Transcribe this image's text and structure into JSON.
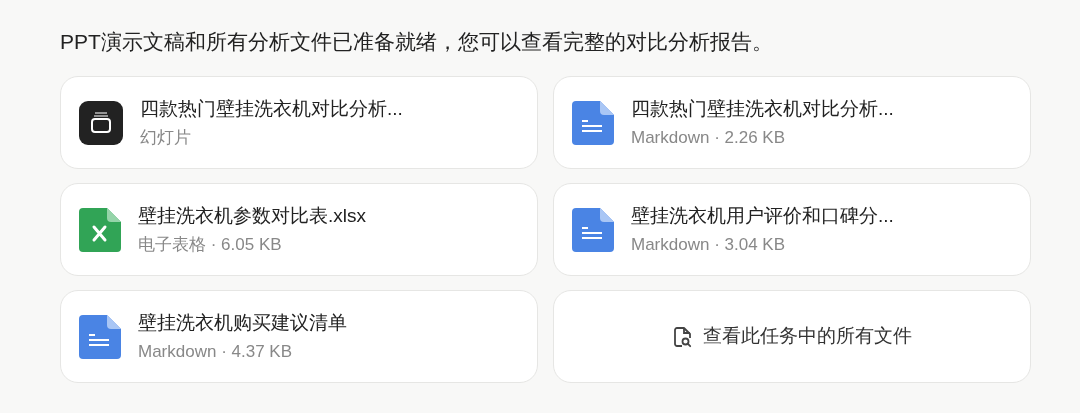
{
  "message": "PPT演示文稿和所有分析文件已准备就绪，您可以查看完整的对比分析报告。",
  "files": [
    {
      "kind": "slides",
      "name": "四款热门壁挂洗衣机对比分析...",
      "meta": "幻灯片"
    },
    {
      "kind": "doc",
      "name": "四款热门壁挂洗衣机对比分析...",
      "meta": "Markdown · 2.26 KB"
    },
    {
      "kind": "sheet",
      "name": "壁挂洗衣机参数对比表.xlsx",
      "meta": "电子表格 · 6.05 KB"
    },
    {
      "kind": "doc",
      "name": "壁挂洗衣机用户评价和口碑分...",
      "meta": "Markdown · 3.04 KB"
    },
    {
      "kind": "doc",
      "name": "壁挂洗衣机购买建议清单",
      "meta": "Markdown · 4.37 KB"
    }
  ],
  "view_all": {
    "label": "查看此任务中的所有文件"
  }
}
